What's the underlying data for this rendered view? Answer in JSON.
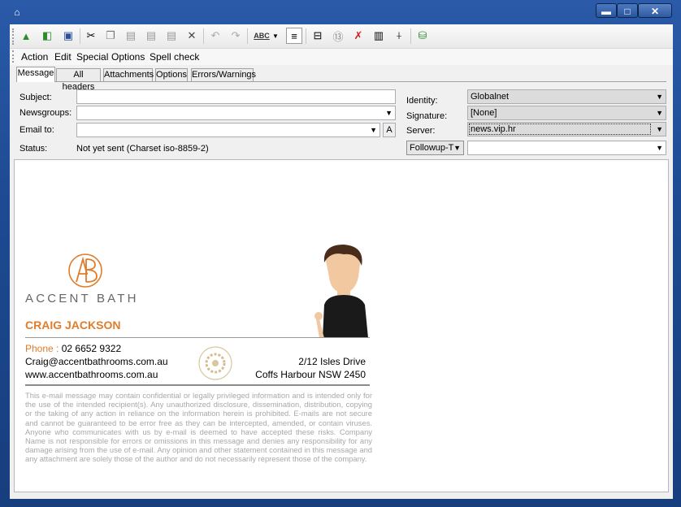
{
  "window": {
    "controls": {
      "minimize": "▬",
      "maximize": "□",
      "close": "✕"
    }
  },
  "toolbar": {
    "icons": [
      "send-icon",
      "send-later-icon",
      "save-draft-icon",
      "cut-icon",
      "copy-icon",
      "paste-icon",
      "paste-quote-icon",
      "paste-special-icon",
      "delete-icon",
      "undo-icon",
      "redo-icon",
      "spell-check-icon",
      "view-headers-icon",
      "layout-icon",
      "rot13-icon",
      "no-signature-icon",
      "attach-icon",
      "wrap-icon",
      "encrypt-icon"
    ]
  },
  "menu": {
    "items": [
      "Action",
      "Edit",
      "Special",
      "Options",
      "Spell check"
    ]
  },
  "tabs": [
    "Message",
    "All headers",
    "Attachments",
    "Options",
    "Errors/Warnings"
  ],
  "form": {
    "subject_label": "Subject:",
    "subject_value": "",
    "newsgroups_label": "Newsgroups:",
    "newsgroups_value": "",
    "email_label": "Email to:",
    "email_value": "",
    "address_book_btn": "A",
    "status_label": "Status:",
    "status_value": "Not yet sent (Charset iso-8859-2)",
    "identity_label": "Identity:",
    "identity_value": "Globalnet",
    "signature_label": "Signature:",
    "signature_value": "[None]",
    "server_label": "Server:",
    "server_value": "news.vip.hr",
    "followup_label": "Followup-T",
    "followup_value": ""
  },
  "signature": {
    "logo_text": "ACCENT BATH",
    "name": "CRAIG JACKSON",
    "phone_label": "Phone",
    "phone_value": "02 6652 9322",
    "email": "Craig@accentbathrooms.com.au",
    "website": "www.accentbathrooms.com.au",
    "address1": "2/12 Isles Drive",
    "address2": "Coffs Harbour NSW 2450",
    "disclaimer": "This e-mail message may contain confidential or legally privileged information and is intended only for the use of the intended recipient(s). Any unauthorized disclosure, dissemination, distribution, copying or the taking of any action in reliance on the information herein is prohibited. E-mails are not secure and cannot be guaranteed to be error free as they can be intercepted, amended, or contain viruses. Anyone who communicates with us by e-mail is deemed to have accepted these risks. Company Name is not responsible for errors or omissions in this message and denies any responsibility for any damage arising from the use of e-mail. Any opinion and other statement contained in this message and any attachment are solely those of the author and do not necessarily represent those of the company."
  },
  "colors": {
    "accent": "#e07c2a",
    "titlebar": "#1d4a92"
  }
}
